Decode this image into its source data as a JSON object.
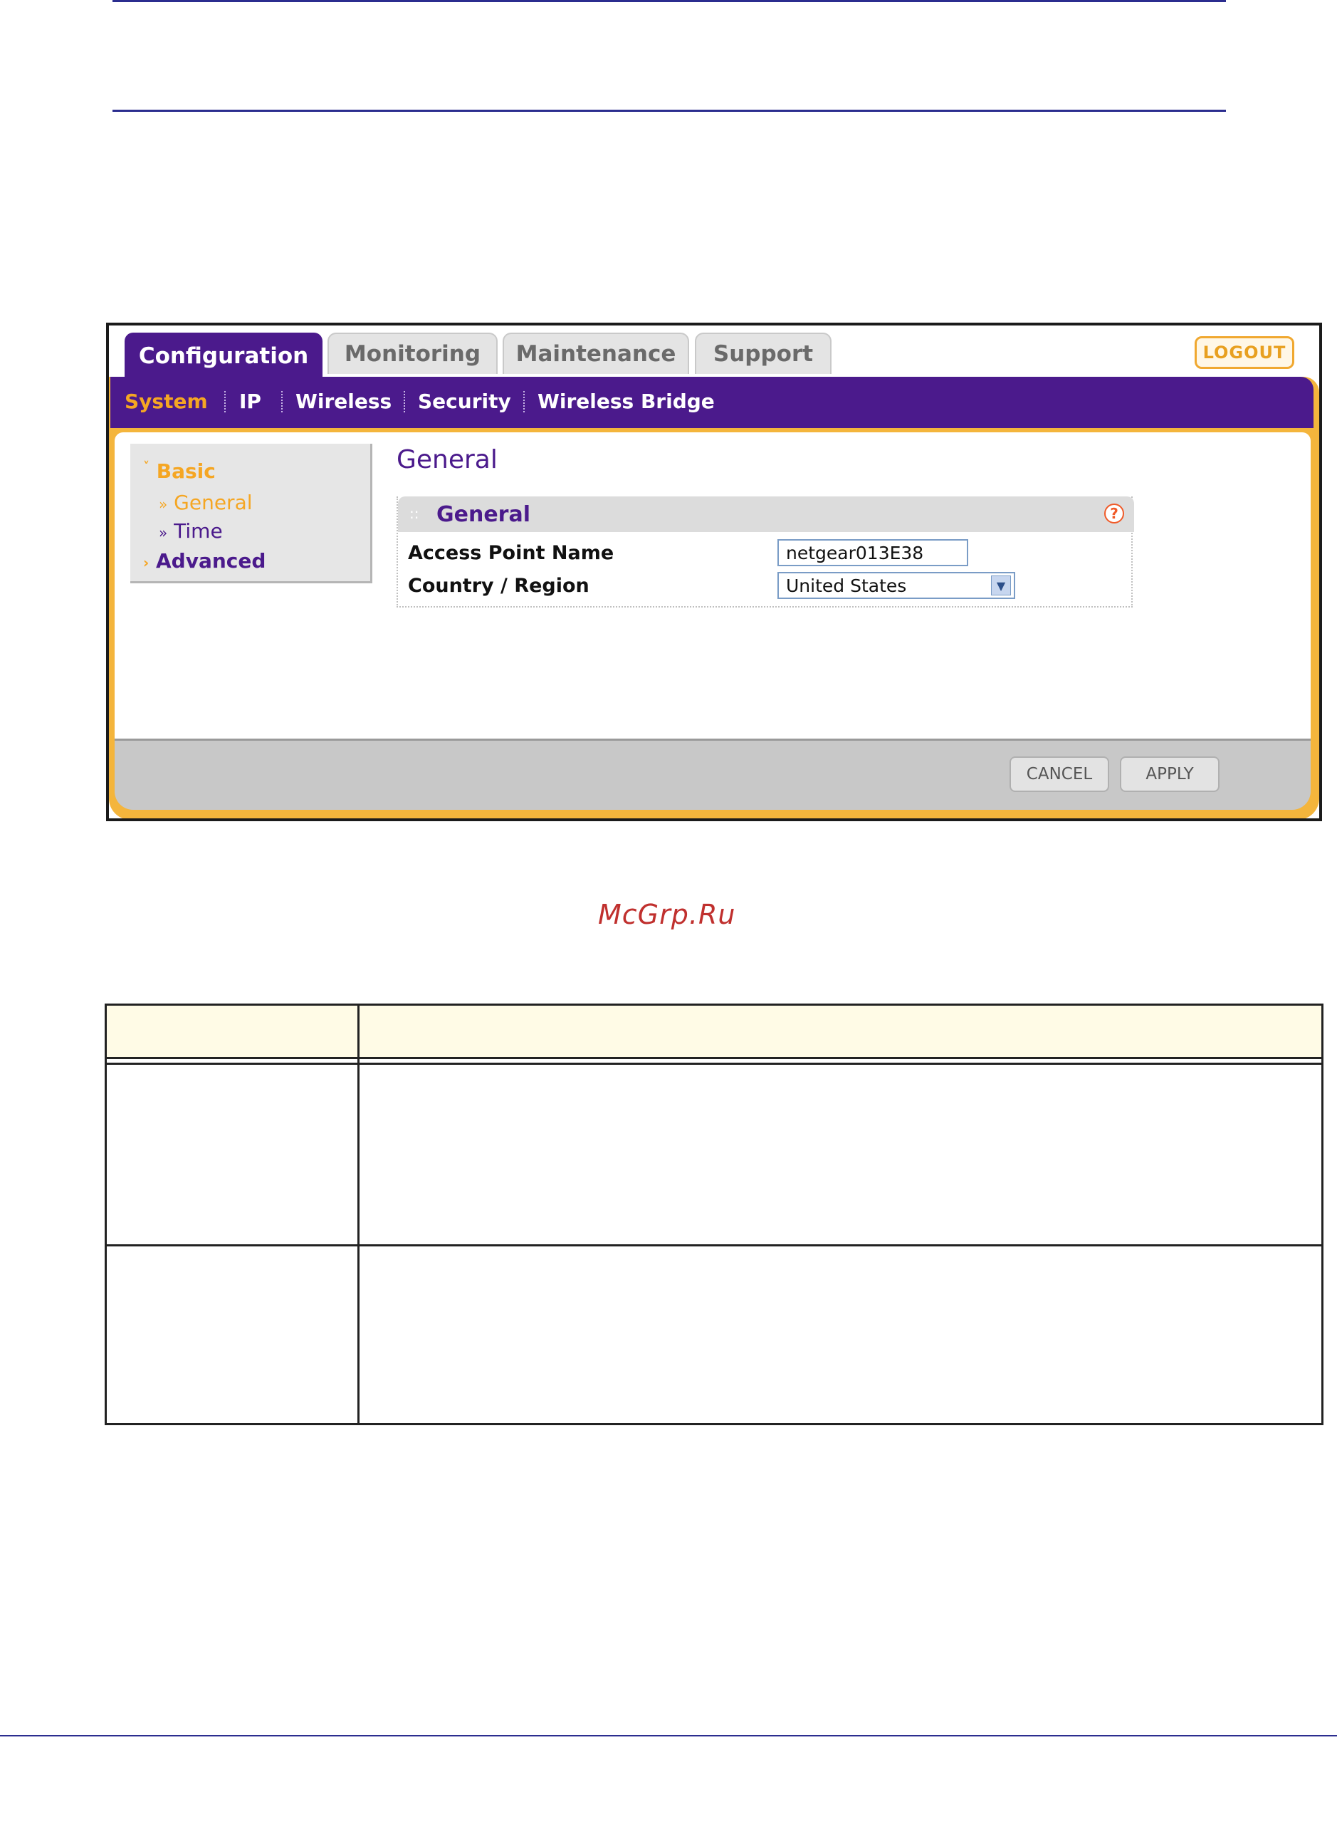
{
  "tabs": [
    {
      "label": "Configuration",
      "active": true
    },
    {
      "label": "Monitoring",
      "active": false
    },
    {
      "label": "Maintenance",
      "active": false
    },
    {
      "label": "Support",
      "active": false
    }
  ],
  "logout_label": "LOGOUT",
  "subnav": [
    {
      "label": "System",
      "selected": true
    },
    {
      "label": "IP",
      "selected": false
    },
    {
      "label": "Wireless",
      "selected": false
    },
    {
      "label": "Security",
      "selected": false
    },
    {
      "label": "Wireless Bridge",
      "selected": false
    }
  ],
  "sidebar": {
    "basic": "Basic",
    "general": "General",
    "time": "Time",
    "advanced": "Advanced"
  },
  "page_title": "General",
  "panel": {
    "title": "General",
    "rows": [
      {
        "label": "Access Point Name",
        "value": "netgear013E38"
      },
      {
        "label": "Country / Region",
        "value": "United States"
      }
    ]
  },
  "buttons": {
    "cancel": "CANCEL",
    "apply": "APPLY"
  },
  "watermark": "McGrp.Ru",
  "colors": {
    "nav_purple": "#4b1a8c",
    "accent_orange": "#f5a623",
    "frame_orange": "#f4b53c",
    "rule_blue": "#2b2d8f",
    "watermark_red": "#c0302e"
  }
}
